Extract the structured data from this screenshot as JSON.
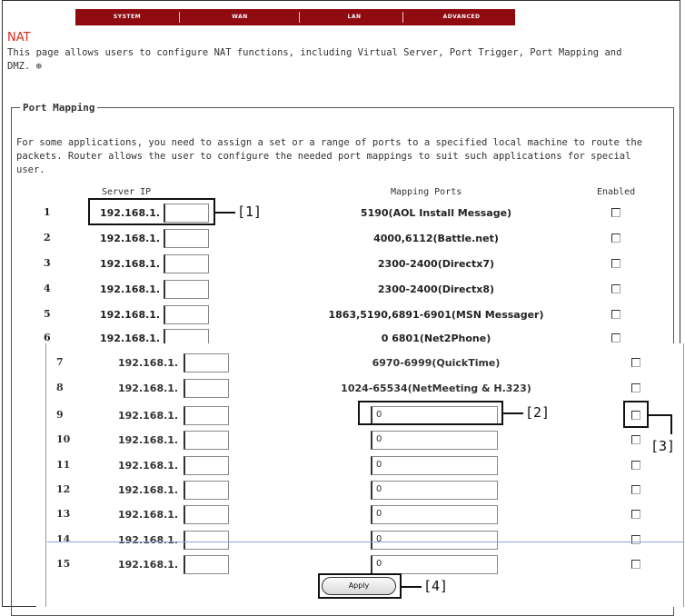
{
  "nav": {
    "tabs": [
      {
        "label": "SYSTEM"
      },
      {
        "label": "WAN"
      },
      {
        "label": "LAN"
      },
      {
        "label": "ADVANCED"
      }
    ],
    "color": "#8f0b10"
  },
  "page": {
    "title": "NAT",
    "title_color": "#e0261b",
    "description": "This page allows users to configure NAT functions, including Virtual Server, Port Trigger, Port Mapping and DMZ. ⊕"
  },
  "port_mapping": {
    "legend": "Port Mapping",
    "description": "For some applications, you need to assign a set or a range of ports to a specified local machine to route the packets. Router allows the user to configure the needed port mappings to suit such applications for special user.",
    "headers": {
      "server_ip": "Server IP",
      "mapping_ports": "Mapping Ports",
      "enabled": "Enabled"
    },
    "rows": [
      {
        "num": "1",
        "ip_prefix": "192.168.1.",
        "ip_suffix": "",
        "mapping": "5190(AOL Install Message)",
        "enabled": false
      },
      {
        "num": "2",
        "ip_prefix": "192.168.1.",
        "ip_suffix": "",
        "mapping": "4000,6112(Battle.net)",
        "enabled": false
      },
      {
        "num": "3",
        "ip_prefix": "192.168.1.",
        "ip_suffix": "",
        "mapping": "2300-2400(Directx7)",
        "enabled": false
      },
      {
        "num": "4",
        "ip_prefix": "192.168.1.",
        "ip_suffix": "",
        "mapping": "2300-2400(Directx8)",
        "enabled": false
      },
      {
        "num": "5",
        "ip_prefix": "192.168.1.",
        "ip_suffix": "",
        "mapping": "1863,5190,6891-6901(MSN Messager)",
        "enabled": false
      },
      {
        "num": "6",
        "ip_prefix": "192.168.1.",
        "ip_suffix": "",
        "mapping": "0 6801(Net2Phone)",
        "enabled": false
      }
    ],
    "lower_rows": [
      {
        "num": "7",
        "ip_prefix": "192.168.1.",
        "ip_suffix": "",
        "mapping": "6970-6999(QuickTime)",
        "port_value": null,
        "enabled": false
      },
      {
        "num": "8",
        "ip_prefix": "192.168.1.",
        "ip_suffix": "",
        "mapping": "1024-65534(NetMeeting & H.323)",
        "port_value": null,
        "enabled": false
      },
      {
        "num": "9",
        "ip_prefix": "192.168.1.",
        "ip_suffix": "",
        "mapping": null,
        "port_value": "0",
        "enabled": false
      },
      {
        "num": "10",
        "ip_prefix": "192.168.1.",
        "ip_suffix": "",
        "mapping": null,
        "port_value": "0",
        "enabled": false
      },
      {
        "num": "11",
        "ip_prefix": "192.168.1.",
        "ip_suffix": "",
        "mapping": null,
        "port_value": "0",
        "enabled": false
      },
      {
        "num": "12",
        "ip_prefix": "192.168.1.",
        "ip_suffix": "",
        "mapping": null,
        "port_value": "0",
        "enabled": false
      },
      {
        "num": "13",
        "ip_prefix": "192.168.1.",
        "ip_suffix": "",
        "mapping": null,
        "port_value": "0",
        "enabled": false
      },
      {
        "num": "14",
        "ip_prefix": "192.168.1.",
        "ip_suffix": "",
        "mapping": null,
        "port_value": "0",
        "enabled": false
      },
      {
        "num": "15",
        "ip_prefix": "192.168.1.",
        "ip_suffix": "",
        "mapping": null,
        "port_value": "0",
        "enabled": false
      }
    ],
    "apply_label": "Apply"
  },
  "callouts": {
    "c1": "[1]",
    "c2": "[2]",
    "c3": "[3]",
    "c4": "[4]"
  }
}
